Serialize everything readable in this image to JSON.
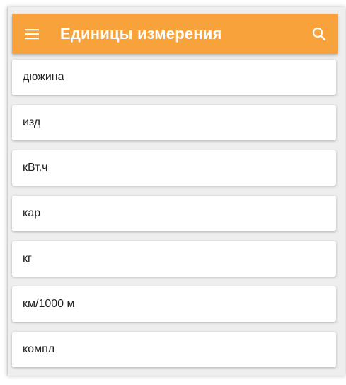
{
  "appbar": {
    "title": "Единицы измерения",
    "color": "#f7a23b",
    "menu_icon": "hamburger-menu-icon",
    "search_icon": "search-icon"
  },
  "units": [
    {
      "label": "дюжина"
    },
    {
      "label": "изд"
    },
    {
      "label": "кВт.ч"
    },
    {
      "label": "кар"
    },
    {
      "label": "кг"
    },
    {
      "label": "км/1000 м"
    },
    {
      "label": "компл"
    }
  ]
}
